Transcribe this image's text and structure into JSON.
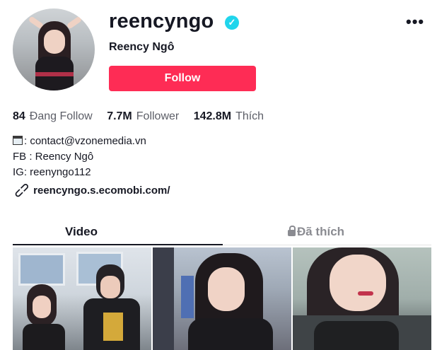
{
  "profile": {
    "username": "reencyngo",
    "nickname": "Reency Ngô",
    "verified_icon": "✓",
    "more_icon": "•••",
    "follow_label": "Follow",
    "accent_color": "#fe2c55"
  },
  "stats": [
    {
      "value": "84",
      "label": "Đang Follow"
    },
    {
      "value": "7.7M",
      "label": "Follower"
    },
    {
      "value": "142.8M",
      "label": "Thích"
    }
  ],
  "bio": {
    "lines": [
      ": contact@vzonemedia.vn",
      "FB : Reency Ngô",
      "IG: reenyngo112"
    ],
    "link": "reencyngo.s.ecomobi.com/"
  },
  "tabs": [
    {
      "label": "Video",
      "active": true
    },
    {
      "label": "Đã thích",
      "active": false,
      "icon": "lock-icon"
    }
  ]
}
